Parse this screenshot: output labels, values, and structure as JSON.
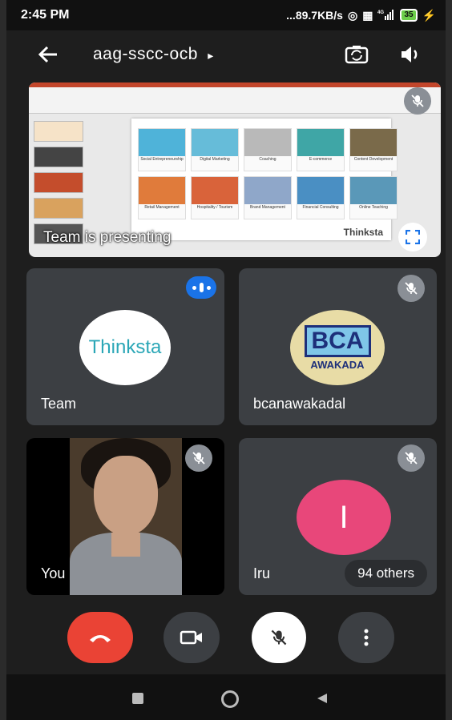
{
  "status": {
    "time": "2:45 PM",
    "network": "...89.7KB/s",
    "signal": "4G",
    "battery": "35"
  },
  "header": {
    "meeting_code": "aag-sscc-ocb",
    "chevron": "▸"
  },
  "presentation": {
    "caption": "Team is presenting",
    "slide_logo": "Thinksta",
    "slide_tiles": [
      "Social Entrepreneurship",
      "Digital Marketing",
      "Coaching",
      "E-commerce",
      "Content Development",
      "Retail Management",
      "Hospitality / Tourism",
      "Brand Management",
      "Financial Consulting",
      "Online Teaching"
    ]
  },
  "participants": [
    {
      "name": "Team",
      "avatar_text": "Thinksta",
      "speaking": true
    },
    {
      "name": "bcanawakadal",
      "avatar_text": "BCA",
      "avatar_subtext": "AWAKADA",
      "muted": true
    },
    {
      "name": "You",
      "muted": true
    },
    {
      "name": "Iru",
      "avatar_letter": "I",
      "muted": true,
      "others": "94 others"
    }
  ],
  "colors": {
    "end_call": "#ea4335",
    "speaking": "#1a73e8",
    "iru_avatar": "#e8477a",
    "tile_bg": "#3c3f43"
  },
  "icons": [
    "back-arrow-icon",
    "camera-switch-icon",
    "speaker-icon",
    "mic-off-icon",
    "fullscreen-icon",
    "end-call-icon",
    "video-icon",
    "more-vert-icon"
  ]
}
